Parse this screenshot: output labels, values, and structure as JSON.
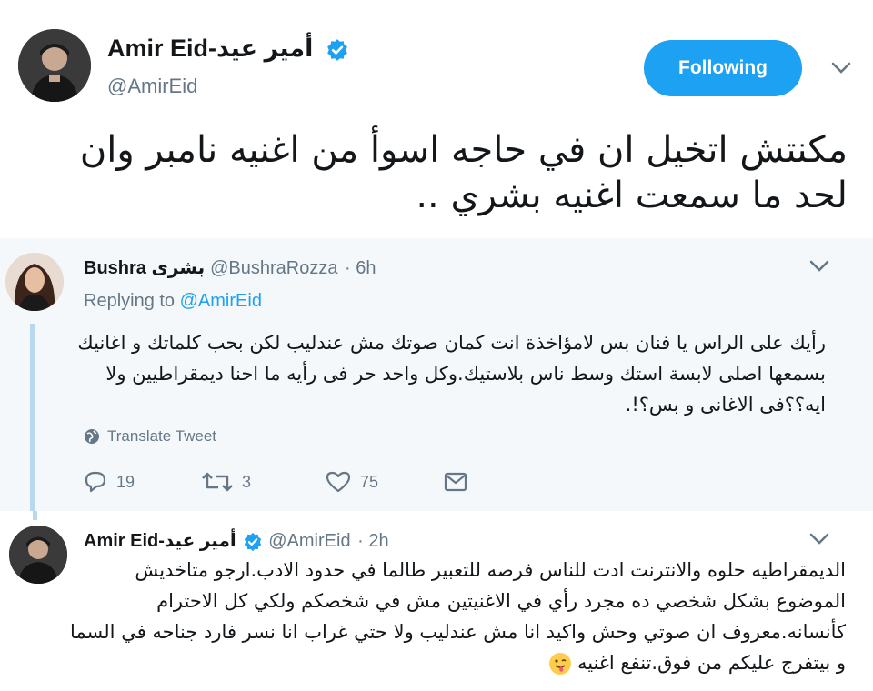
{
  "main_tweet": {
    "name": "Amir Eid-أمير عيد",
    "handle": "@AmirEid",
    "follow_label": "Following",
    "text": "مكنتش اتخيل ان في حاجه اسوأ من اغنيه نامبر وان لحد ما سمعت اغنيه بشري .."
  },
  "reply1": {
    "name": "Bushra بشرى",
    "handle": "@BushraRozza",
    "time": "· 6h",
    "replying_prefix": "Replying to",
    "replying_handle": "@AmirEid",
    "text": "رأيك على الراس يا فنان بس لامؤاخذة انت كمان صوتك مش عندليب لكن بحب كلماتك و اغانيك بسمعها اصلى لابسة استك وسط ناس بلاستيك.وكل واحد حر فى رأيه ما احنا ديمقراطيين ولا ايه؟؟فى الاغانى و بس؟!.",
    "translate_label": "Translate Tweet",
    "reply_count": "19",
    "retweet_count": "3",
    "like_count": "75"
  },
  "reply2": {
    "name": "Amir Eid-أمير عيد",
    "handle": "@AmirEid",
    "time": "· 2h",
    "text": "الديمقراطيه حلوه والانترنت ادت للناس فرصه للتعبير طالما في حدود الادب.ارجو متاخديش الموضوع بشكل شخصي ده مجرد رأي في الاغنيتين مش في شخصكم ولكي كل الاحترام كأنسانه.معروف ان صوتي وحش واكيد انا مش عندليب ولا حتي غراب انا نسر فارد جناحه في السما و بيتفرج عليكم من فوق.تنفع اغنيه"
  },
  "colors": {
    "accent": "#1da1f2",
    "muted": "#657786",
    "reply_bg": "#f5f8fa",
    "thread_line": "#b8d8ee"
  }
}
